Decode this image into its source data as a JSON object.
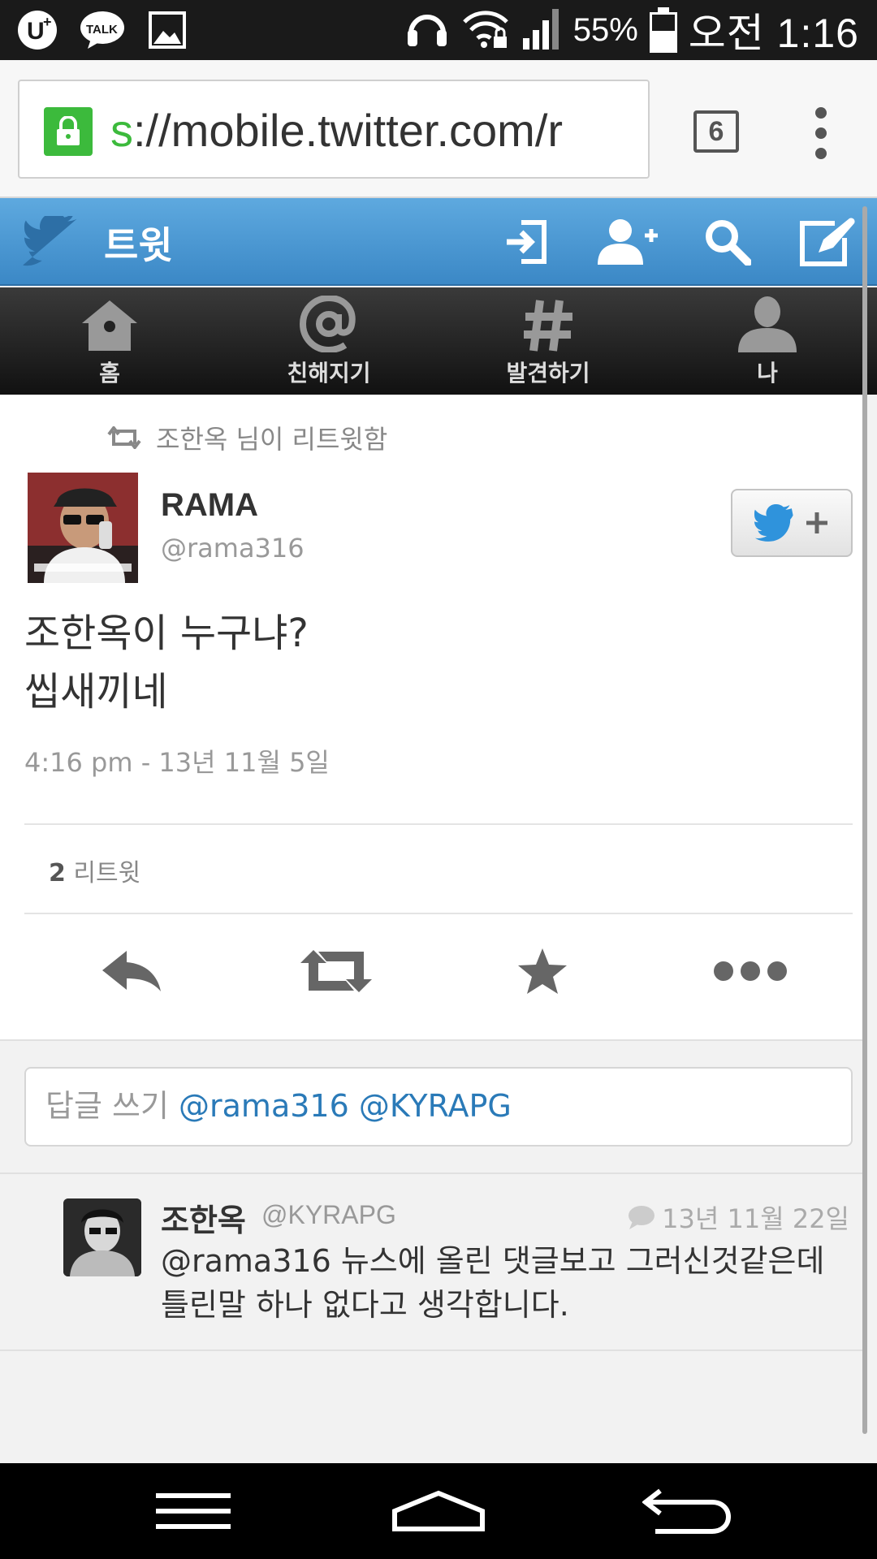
{
  "status_bar": {
    "icons": [
      "uplus-icon",
      "kakaotalk-icon",
      "gallery-icon",
      "headset-icon",
      "wifi-lock-icon",
      "signal-icon",
      "battery-icon"
    ],
    "talk_label": "TALK",
    "battery": "55%",
    "battery_level": 0.55,
    "time": "오전 1:16"
  },
  "browser": {
    "url_scheme": "s",
    "url_rest": "://mobile.twitter.com/r",
    "tab_count": "6"
  },
  "header": {
    "title": "트윗",
    "accent": "#4a97d2"
  },
  "nav": {
    "items": [
      {
        "label": "홈",
        "icon": "home-icon"
      },
      {
        "label": "친해지기",
        "icon": "at-icon"
      },
      {
        "label": "발견하기",
        "icon": "hashtag-icon"
      },
      {
        "label": "나",
        "icon": "profile-icon"
      }
    ]
  },
  "tweet": {
    "retweeted_by": "조한옥 님이 리트윗함",
    "author_name": "RAMA",
    "author_handle": "@rama316",
    "text_line1": "조한옥이 누구냐?",
    "text_line2": "씹새끼네",
    "time": "4:16 pm - 13년 11월 5일",
    "retweet_count": "2",
    "retweet_label": "리트윗"
  },
  "reply_box": {
    "placeholder": "답글 쓰기",
    "mentions": "@rama316 @KYRAPG"
  },
  "reply": {
    "name": "조한옥",
    "handle": "@KYRAPG",
    "date": "13년 11월 22일",
    "text": "@rama316 뉴스에 올린 댓글보고 그러신것같은데 틀린말 하나 없다고 생각합니다."
  }
}
